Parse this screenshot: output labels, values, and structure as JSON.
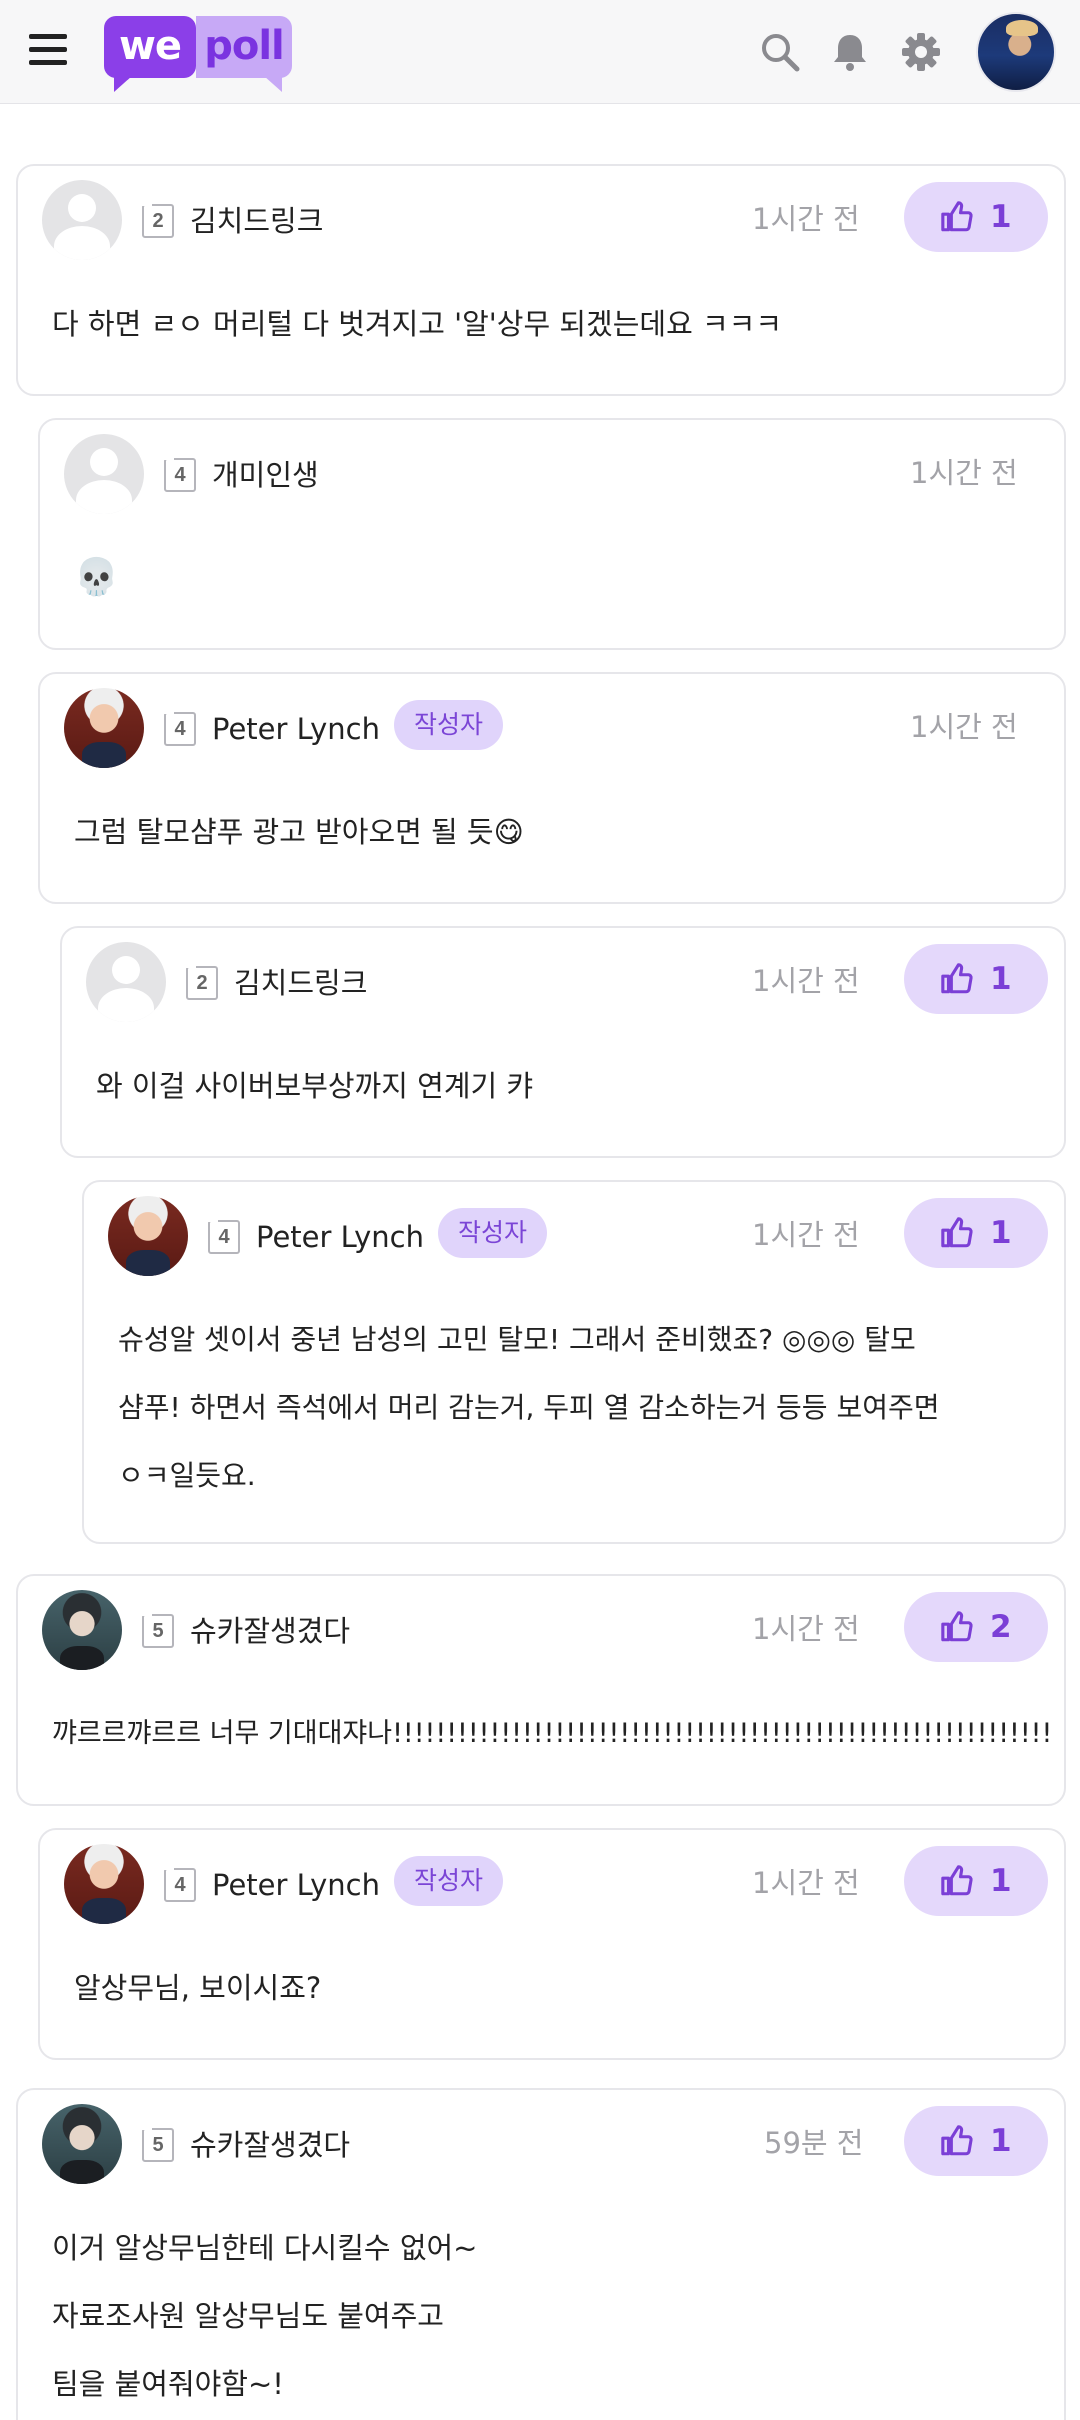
{
  "app": {
    "logo_we": "we",
    "logo_poll": "poll"
  },
  "header": {
    "icons": [
      "menu-icon",
      "search-icon",
      "bell-icon",
      "gear-icon"
    ]
  },
  "comments": [
    {
      "avatar": "default",
      "level": "2",
      "nickname": "김치드링크",
      "is_author": false,
      "time": "1시간 전",
      "likes": "1",
      "text": "다 하면 ㄹㅇ 머리털 다 벗겨지고 '알'상무 되겠는데요 ㅋㅋㅋ"
    },
    {
      "avatar": "default",
      "level": "4",
      "nickname": "개미인생",
      "is_author": false,
      "time": "1시간 전",
      "likes": null,
      "text": "💀"
    },
    {
      "avatar": "peter",
      "level": "4",
      "nickname": "Peter Lynch",
      "is_author": true,
      "time": "1시간 전",
      "likes": null,
      "text": "그럼 탈모샴푸 광고 받아오면 될 듯😋"
    },
    {
      "avatar": "default",
      "level": "2",
      "nickname": "김치드링크",
      "is_author": false,
      "time": "1시간 전",
      "likes": "1",
      "text": "와 이걸 사이버보부상까지 연계기 캬"
    },
    {
      "avatar": "peter",
      "level": "4",
      "nickname": "Peter Lynch",
      "is_author": true,
      "time": "1시간 전",
      "likes": "1",
      "text": "슈성알 셋이서 중년 남성의 고민 탈모! 그래서 준비했죠? ◎◎◎ 탈모\n샴푸! 하면서 즉석에서 머리 감는거, 두피 열 감소하는거 등등 보여주면\nㅇㅋ일듯요."
    },
    {
      "avatar": "suga",
      "level": "5",
      "nickname": "슈카잘생겼다",
      "is_author": false,
      "time": "1시간 전",
      "likes": "2",
      "text": "꺄르르꺄르르 너무 기대대쟈나!!!!!!!!!!!!!!!!!!!!!!!!!!!!!!!!!!!!!!!!!!!!!!!!!!!!!!!!!!!!!!!!!!!!!!!!!!!!"
    },
    {
      "avatar": "peter",
      "level": "4",
      "nickname": "Peter Lynch",
      "is_author": true,
      "time": "1시간 전",
      "likes": "1",
      "text": "알상무님, 보이시죠?"
    },
    {
      "avatar": "suga",
      "level": "5",
      "nickname": "슈카잘생겼다",
      "is_author": false,
      "time": "59분 전",
      "likes": "1",
      "text": "이거 알상무님한테 다시킬수 없어~\n자료조사원 알상무님도 붙여주고\n팀을 붙여줘야함~!"
    }
  ],
  "labels": {
    "author_badge": "작성자"
  },
  "colors": {
    "brand_purple": "#8b3fe8",
    "like_bg": "#e4d8fb",
    "like_text": "#7b3fd6",
    "badge_bg": "#e0d4fb"
  }
}
